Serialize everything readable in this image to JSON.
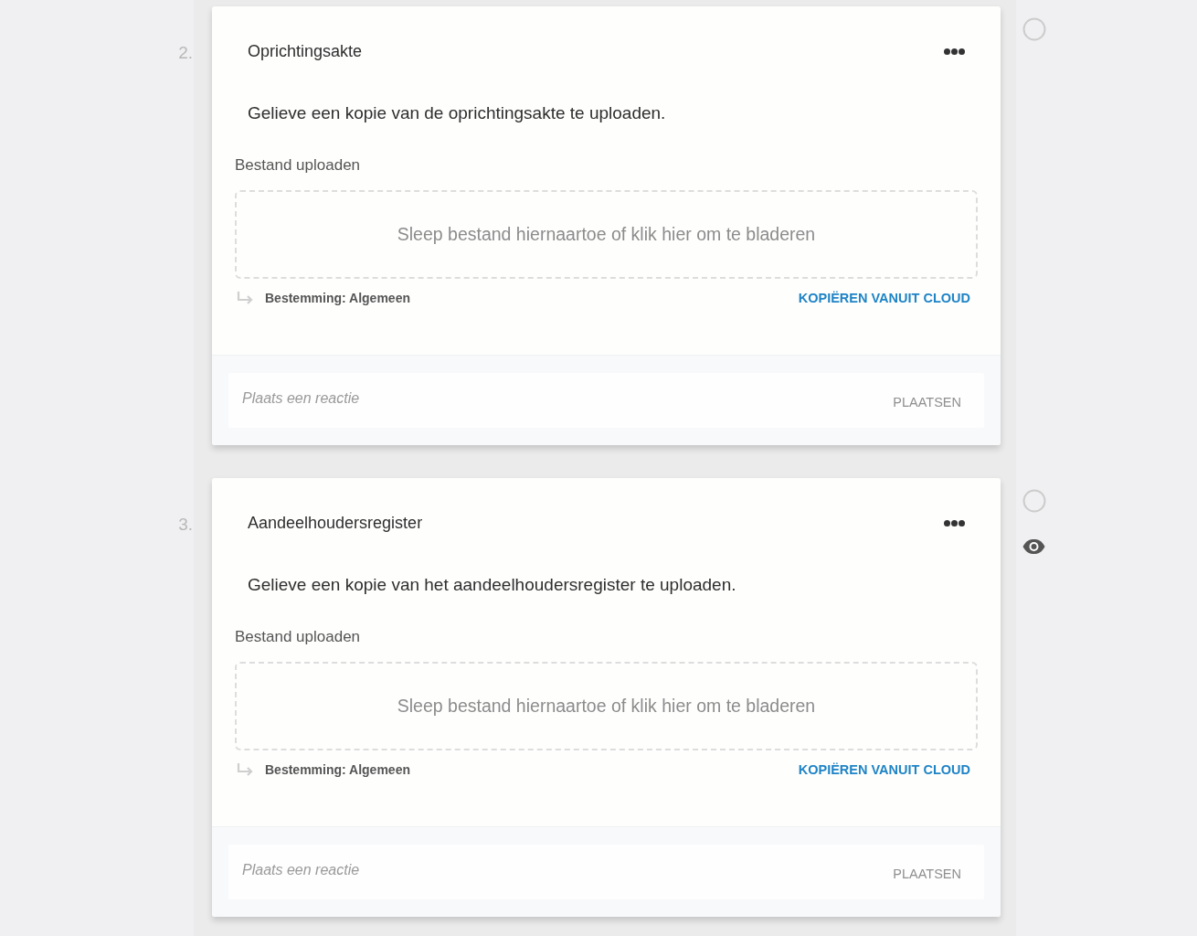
{
  "items": [
    {
      "number": "2.",
      "title": "Oprichtingsakte",
      "description": "Gelieve een kopie van de oprichtingsakte te uploaden.",
      "upload": {
        "label": "Bestand uploaden",
        "dropzone_text": "Sleep bestand hiernaartoe of klik hier om te bladeren",
        "destination": "Bestemming: Algemeen",
        "cloud_link": "KOPIËREN VANUIT CLOUD"
      },
      "comment": {
        "placeholder": "Plaats een reactie",
        "button": "PLAATSEN"
      },
      "checked": false,
      "watched": false
    },
    {
      "number": "3.",
      "title": "Aandeelhoudersregister",
      "description": "Gelieve een kopie van het aandeelhoudersregister te uploaden.",
      "upload": {
        "label": "Bestand uploaden",
        "dropzone_text": "Sleep bestand hiernaartoe of klik hier om te bladeren",
        "destination": "Bestemming: Algemeen",
        "cloud_link": "KOPIËREN VANUIT CLOUD"
      },
      "comment": {
        "placeholder": "Plaats een reactie",
        "button": "PLAATSEN"
      },
      "checked": false,
      "watched": true
    }
  ]
}
